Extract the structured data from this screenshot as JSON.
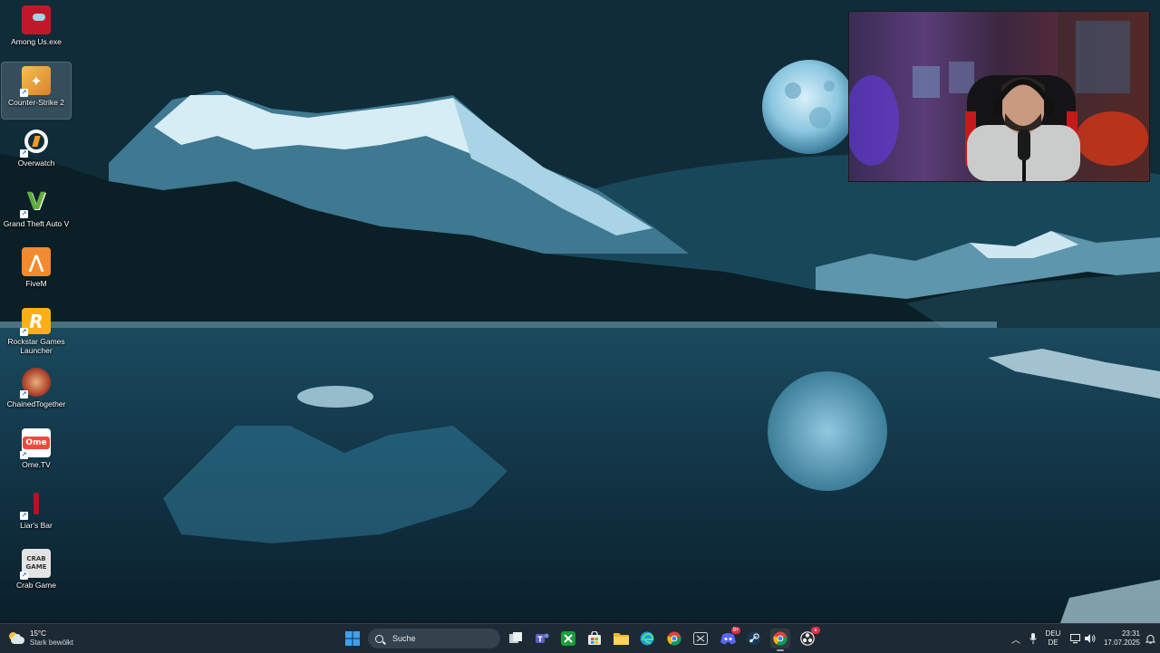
{
  "desktop": {
    "icons": [
      {
        "name": "among-us-icon",
        "label": "Among Us.exe",
        "shortcut": false,
        "selected": false,
        "color": "#c0182a"
      },
      {
        "name": "counter-strike-2-icon",
        "label": "Counter-Strike 2",
        "shortcut": true,
        "selected": true,
        "color": "#e2a13a"
      },
      {
        "name": "overwatch-icon",
        "label": "Overwatch",
        "shortcut": true,
        "selected": false,
        "color": "#f59a23"
      },
      {
        "name": "gta-v-icon",
        "label": "Grand Theft Auto V",
        "shortcut": true,
        "selected": false,
        "color": "#4d9a2e"
      },
      {
        "name": "fivem-icon",
        "label": "FiveM",
        "shortcut": false,
        "selected": false,
        "color": "#f28b30"
      },
      {
        "name": "rockstar-launcher-icon",
        "label": "Rockstar Games Launcher",
        "shortcut": true,
        "selected": false,
        "color": "#fcaf17"
      },
      {
        "name": "chained-together-icon",
        "label": "ChainedTogether",
        "shortcut": true,
        "selected": false,
        "color": "#b0452e"
      },
      {
        "name": "ome-tv-icon",
        "label": "Ome.TV",
        "shortcut": true,
        "selected": false,
        "color": "#ef4a3d"
      },
      {
        "name": "liars-bar-icon",
        "label": "Liar's Bar",
        "shortcut": true,
        "selected": false,
        "color": "#8a0f16"
      },
      {
        "name": "crab-game-icon",
        "label": "Crab Game",
        "shortcut": true,
        "selected": false,
        "color": "#d8d8d8"
      }
    ]
  },
  "icon_glyphs": {
    "fivem": "⋀",
    "rockstar": "R",
    "ome": "Ome",
    "crab": "CRAB GAME",
    "gta": "V"
  },
  "taskbar": {
    "weather": {
      "temp": "15°C",
      "condition": "Stark bewölkt",
      "icon": "cloud-sun-icon"
    },
    "search_placeholder": "Suche",
    "apps": [
      {
        "name": "start-button",
        "icon": "windows-logo-icon"
      },
      {
        "name": "task-view-button",
        "icon": "task-view-icon"
      },
      {
        "name": "teams-button",
        "icon": "teams-icon"
      },
      {
        "name": "xbox-button",
        "icon": "xbox-icon"
      },
      {
        "name": "store-button",
        "icon": "store-icon"
      },
      {
        "name": "file-explorer-button",
        "icon": "folder-icon"
      },
      {
        "name": "edge-button",
        "icon": "edge-icon"
      },
      {
        "name": "chrome-button",
        "icon": "chrome-icon"
      },
      {
        "name": "snipping-tool-button",
        "icon": "snip-icon"
      },
      {
        "name": "discord-button",
        "icon": "discord-icon",
        "badge": "9+"
      },
      {
        "name": "steam-button",
        "icon": "steam-icon"
      },
      {
        "name": "chrome-profile-button",
        "icon": "chrome-icon",
        "active": true
      },
      {
        "name": "obs-button",
        "icon": "obs-icon",
        "badge": "●"
      }
    ],
    "tray": {
      "language_top": "DEU",
      "language_bottom": "DE",
      "time": "23:31",
      "date": "17.07.2025"
    }
  },
  "colors": {
    "taskbar_bg": "#1e2a33",
    "accent": "#3b8ee8"
  }
}
